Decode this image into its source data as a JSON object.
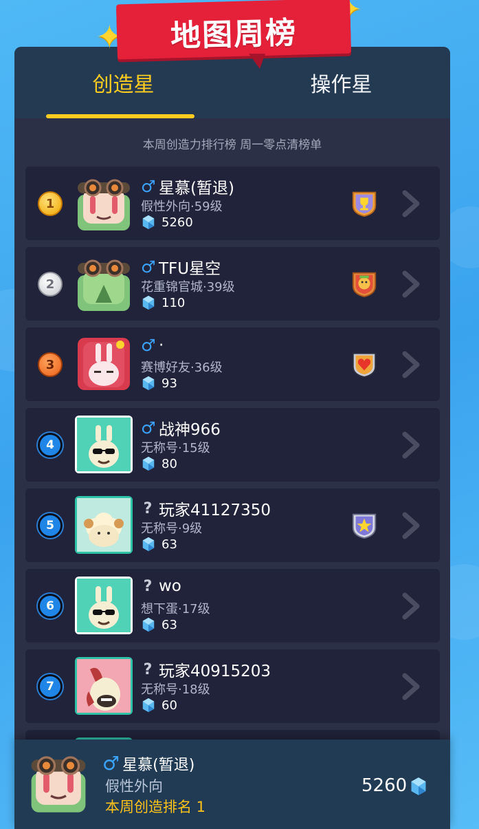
{
  "banner": {
    "title": "地图周榜"
  },
  "tabs": [
    {
      "label": "创造星",
      "active": true
    },
    {
      "label": "操作星",
      "active": false
    }
  ],
  "subtitle": "本周创造力排行榜 周一零点清榜单",
  "colors": {
    "accent": "#ffcc1f",
    "panel": "#2c3047",
    "row": "#21233a",
    "male": "#3ba3ff",
    "rank_blue": "#1f86e8",
    "ribbon": "#e5213a"
  },
  "rows": [
    {
      "rank": "1",
      "gender": "♂",
      "name": "星慕(暂退)",
      "sub": "假性外向·59级",
      "score": "5260",
      "badge": "trophy-badge-icon",
      "avatar": "goggles-bunny-avatar"
    },
    {
      "rank": "2",
      "gender": "♂",
      "name": "TFU星空",
      "sub": "花重锦官城·39级",
      "score": "110",
      "badge": "lion-badge-icon",
      "avatar": "goggles-dino-avatar"
    },
    {
      "rank": "3",
      "gender": "♂",
      "name": "·",
      "sub": "赛博好友·36级",
      "score": "93",
      "badge": "heart-badge-icon",
      "avatar": "red-bunny-avatar"
    },
    {
      "rank": "4",
      "gender": "♂",
      "name": "战神966",
      "sub": "无称号·15级",
      "score": "80",
      "badge": "",
      "avatar": "sunglasses-bunny-avatar"
    },
    {
      "rank": "5",
      "gender": "?",
      "name": "玩家41127350",
      "sub": "无称号·9级",
      "score": "63",
      "badge": "star-badge-icon",
      "avatar": "sheep-avatar"
    },
    {
      "rank": "6",
      "gender": "?",
      "name": "wo",
      "sub": "想下蛋·17级",
      "score": "63",
      "badge": "",
      "avatar": "sunglasses-bunny-avatar"
    },
    {
      "rank": "7",
      "gender": "?",
      "name": "玩家40915203",
      "sub": "无称号·18级",
      "score": "60",
      "badge": "",
      "avatar": "horse-avatar"
    }
  ],
  "footer": {
    "gender": "♂",
    "name": "星慕(暂退)",
    "tag": "假性外向",
    "rank_text": "本周创造排名 1",
    "score": "5260"
  }
}
